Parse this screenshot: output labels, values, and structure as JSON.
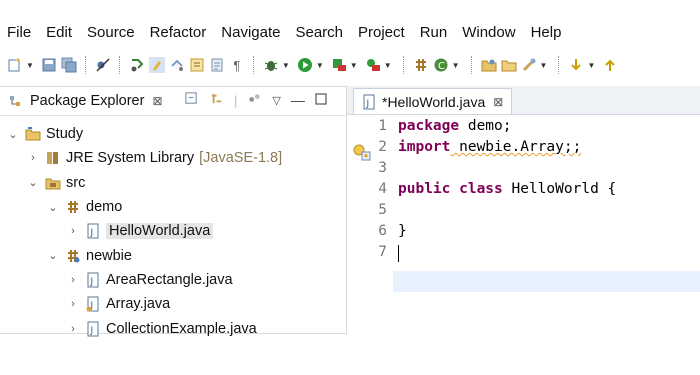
{
  "menu": [
    "File",
    "Edit",
    "Source",
    "Refactor",
    "Navigate",
    "Search",
    "Project",
    "Run",
    "Window",
    "Help"
  ],
  "toolbar": {
    "icons": [
      "new-icon",
      "save-icon",
      "save-all-icon",
      "skip-breakpoints-icon",
      "toggle-mark-occurrences-icon",
      "highlighter-icon",
      "open-task-icon",
      "open-type-icon",
      "show-whitespace-icon",
      "debug-icon",
      "run-icon",
      "coverage-icon",
      "external-tools-icon",
      "new-java-package-icon",
      "new-java-class-icon",
      "open-folder-icon",
      "search-icon",
      "next-annotation-icon",
      "previous-annotation-icon"
    ]
  },
  "explorer": {
    "title": "Package Explorer",
    "close": "⊠",
    "tree": [
      {
        "label": "Study",
        "icon": "project-icon",
        "twisty": "⌄"
      },
      {
        "label": "JRE System Library",
        "decoration": "[JavaSE-1.8]",
        "icon": "library-icon",
        "twisty": "›"
      },
      {
        "label": "src",
        "icon": "source-folder-icon",
        "twisty": "⌄"
      },
      {
        "label": "demo",
        "icon": "package-icon",
        "twisty": "⌄"
      },
      {
        "label": "HelloWorld.java",
        "icon": "java-file-icon",
        "twisty": "›"
      },
      {
        "label": "newbie",
        "icon": "package-icon",
        "twisty": "⌄"
      },
      {
        "label": "AreaRectangle.java",
        "icon": "java-file-icon",
        "twisty": "›"
      },
      {
        "label": "Array.java",
        "icon": "java-file-icon",
        "twisty": "›"
      },
      {
        "label": "CollectionExample.java",
        "icon": "java-file-icon",
        "twisty": "›"
      }
    ]
  },
  "editor": {
    "tab_title": "*HelloWorld.java",
    "tab_close": "⊠",
    "lines": [
      {
        "num": "1",
        "kw": "package",
        "rest": " demo;"
      },
      {
        "num": "2",
        "kw": "import",
        "rest": " newbie.Array;;"
      },
      {
        "num": "3",
        "kw": "",
        "rest": ""
      },
      {
        "num": "4",
        "kw": "public class",
        "rest": " HelloWorld {"
      },
      {
        "num": "5",
        "kw": "",
        "rest": ""
      },
      {
        "num": "6",
        "kw": "",
        "rest": "}"
      },
      {
        "num": "7",
        "kw": "",
        "rest": ""
      }
    ]
  },
  "colors": {
    "keyword": "#7f0055",
    "current_line": "#e8f2fe",
    "selection": "#e5e5e5"
  }
}
